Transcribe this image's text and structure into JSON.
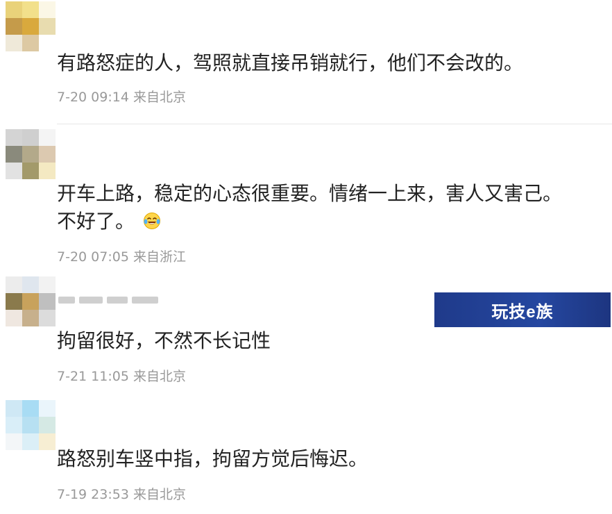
{
  "comments": [
    {
      "text": "有路怒症的人，驾照就直接吊销就行，他们不会改的。",
      "meta": "7-20 09:14 来自北京"
    },
    {
      "text_line1": "开车上路，稳定的心态很重要。情绪一上来，害人又害己。",
      "text_line2": "不好了。",
      "emoji": "laughing-tears-icon",
      "meta": "7-20 07:05 来自浙江"
    },
    {
      "text": "拘留很好，不然不长记性",
      "meta": "7-21 11:05 来自北京"
    },
    {
      "text": "路怒别车竖中指，拘留方觉后悔迟。",
      "meta": "7-19 23:53 来自北京"
    }
  ],
  "watermark": {
    "label": "玩技e族"
  },
  "colors": {
    "text": "#222222",
    "meta": "#999999",
    "divider": "#e6e6e6",
    "watermark_bg": "#2547a0"
  }
}
